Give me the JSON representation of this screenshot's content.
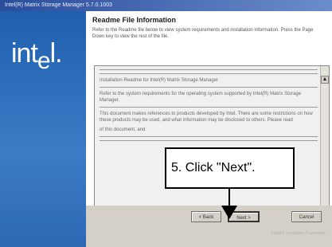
{
  "window": {
    "title": "Intel(R) Matrix Storage Manager 5.7.0.1003"
  },
  "brand": {
    "logo_main": "int",
    "logo_e": "e",
    "logo_end": "l."
  },
  "page": {
    "heading": "Readme File Information",
    "intro": "Refer to the Readme file below to view system requirements and installation information. Press the Page Down key to view the rest of the file."
  },
  "readme": {
    "lines": [
      "Installation Readme for Intel(R) Matrix Storage Manager",
      "Refer to the system requirements for the operating system supported by Intel(R) Matrix Storage Manager.",
      "This document makes references to products developed by Intel. There are some restrictions on how these products may be used, and what information may be disclosed to others. Please read",
      "of this document, and"
    ]
  },
  "scroll": {
    "up_glyph": "▲",
    "down_glyph": "▼"
  },
  "buttons": {
    "back": "< Back",
    "next": "Next >",
    "cancel": "Cancel"
  },
  "footer": {
    "brand": "Intel(R) Installation Framework"
  },
  "callout": {
    "text": "5.  Click \"Next\"."
  }
}
